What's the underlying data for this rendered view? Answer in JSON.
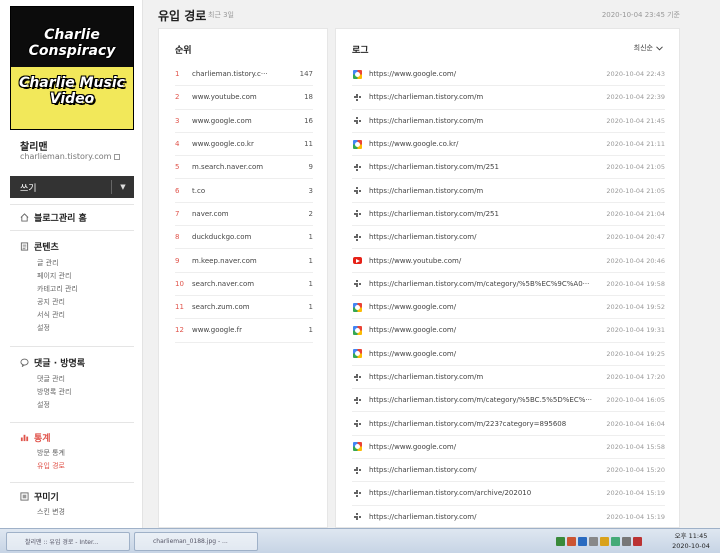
{
  "sidebar": {
    "thumb": {
      "line1": "Charlie Conspiracy",
      "line2": "Charlie Music Video"
    },
    "blog_name": "찰리맨",
    "blog_url": "charlieman.tistory.com",
    "write_label": "쓰기",
    "home_label": "블로그관리 홈",
    "sections": [
      {
        "title": "콘텐츠",
        "items": [
          "글 관리",
          "페이지 관리",
          "카테고리 관리",
          "공지 관리",
          "서식 관리",
          "설정"
        ]
      },
      {
        "title": "댓글 · 방명록",
        "items": [
          "댓글 관리",
          "방명록 관리",
          "설정"
        ]
      },
      {
        "title": "통계",
        "items": [
          "방문 통계",
          "유입 경로"
        ]
      },
      {
        "title": "꾸미기",
        "items": [
          "스킨 변경"
        ]
      }
    ]
  },
  "header": {
    "title": "유입 경로",
    "subtitle": "최근 3일",
    "date": "2020-10-04 23:45 기준"
  },
  "rank": {
    "heading": "순위",
    "rows": [
      {
        "num": "1",
        "site": "charlieman.tistory.c···",
        "count": "147"
      },
      {
        "num": "2",
        "site": "www.youtube.com",
        "count": "18"
      },
      {
        "num": "3",
        "site": "www.google.com",
        "count": "16"
      },
      {
        "num": "4",
        "site": "www.google.co.kr",
        "count": "11"
      },
      {
        "num": "5",
        "site": "m.search.naver.com",
        "count": "9"
      },
      {
        "num": "6",
        "site": "t.co",
        "count": "3"
      },
      {
        "num": "7",
        "site": "naver.com",
        "count": "2"
      },
      {
        "num": "8",
        "site": "duckduckgo.com",
        "count": "1"
      },
      {
        "num": "9",
        "site": "m.keep.naver.com",
        "count": "1"
      },
      {
        "num": "10",
        "site": "search.naver.com",
        "count": "1"
      },
      {
        "num": "11",
        "site": "search.zum.com",
        "count": "1"
      },
      {
        "num": "12",
        "site": "www.google.fr",
        "count": "1"
      }
    ]
  },
  "log": {
    "heading": "로그",
    "sort_label": "최신순",
    "rows": [
      {
        "icon": "google-icon",
        "url": "https://www.google.com/",
        "time": "2020-10-04 22:43"
      },
      {
        "icon": "tistory-icon",
        "url": "https://charlieman.tistory.com/m",
        "time": "2020-10-04 22:39"
      },
      {
        "icon": "tistory-icon",
        "url": "https://charlieman.tistory.com/m",
        "time": "2020-10-04 21:45"
      },
      {
        "icon": "google-icon",
        "url": "https://www.google.co.kr/",
        "time": "2020-10-04 21:11"
      },
      {
        "icon": "tistory-icon",
        "url": "https://charlieman.tistory.com/m/251",
        "time": "2020-10-04 21:05"
      },
      {
        "icon": "tistory-icon",
        "url": "https://charlieman.tistory.com/m",
        "time": "2020-10-04 21:05"
      },
      {
        "icon": "tistory-icon",
        "url": "https://charlieman.tistory.com/m/251",
        "time": "2020-10-04 21:04"
      },
      {
        "icon": "tistory-icon",
        "url": "https://charlieman.tistory.com/",
        "time": "2020-10-04 20:47"
      },
      {
        "icon": "youtube-icon",
        "url": "https://www.youtube.com/",
        "time": "2020-10-04 20:46"
      },
      {
        "icon": "tistory-icon",
        "url": "https://charlieman.tistory.com/m/category/%5B%EC%9C%A0···",
        "time": "2020-10-04 19:58"
      },
      {
        "icon": "google-icon",
        "url": "https://www.google.com/",
        "time": "2020-10-04 19:52"
      },
      {
        "icon": "google-icon",
        "url": "https://www.google.com/",
        "time": "2020-10-04 19:31"
      },
      {
        "icon": "google-icon",
        "url": "https://www.google.com/",
        "time": "2020-10-04 19:25"
      },
      {
        "icon": "tistory-icon",
        "url": "https://charlieman.tistory.com/m",
        "time": "2020-10-04 17:20"
      },
      {
        "icon": "tistory-icon",
        "url": "https://charlieman.tistory.com/m/category/%5BC.5%5D%EC%···",
        "time": "2020-10-04 16:05"
      },
      {
        "icon": "tistory-icon",
        "url": "https://charlieman.tistory.com/m/223?category=895608",
        "time": "2020-10-04 16:04"
      },
      {
        "icon": "google-icon",
        "url": "https://www.google.com/",
        "time": "2020-10-04 15:58"
      },
      {
        "icon": "tistory-icon",
        "url": "https://charlieman.tistory.com/",
        "time": "2020-10-04 15:20"
      },
      {
        "icon": "tistory-icon",
        "url": "https://charlieman.tistory.com/archive/202010",
        "time": "2020-10-04 15:19"
      },
      {
        "icon": "tistory-icon",
        "url": "https://charlieman.tistory.com/",
        "time": "2020-10-04 15:19"
      }
    ]
  },
  "taskbar": {
    "tasks": [
      "찰리맨 :: 유입 경로 - Inter...",
      "charlieman_0188.jpg - ..."
    ],
    "clock_time": "오후 11:45",
    "clock_date": "2020-10-04"
  }
}
